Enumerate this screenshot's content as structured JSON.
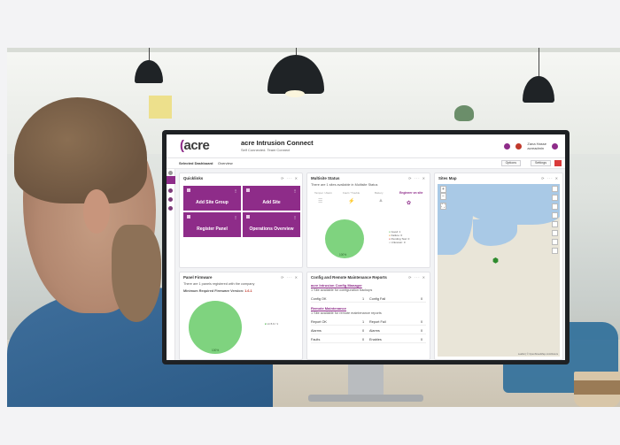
{
  "app": {
    "logo_text": "acre",
    "title": "acre Intrusion Connect",
    "subtitle": "Self Connected. Team Connect",
    "user": [
      "Zana Hasse",
      "acreadmin"
    ]
  },
  "subbar": {
    "selected_label": "Selected Dashboard",
    "dashboard_value": "Overview",
    "views_button": "Options",
    "settings_button": "Settings"
  },
  "quicklinks": {
    "title": "Quicklinks",
    "tiles": [
      "Add Site Group",
      "Add Site",
      "Register Panel",
      "Operations Overview"
    ]
  },
  "multisite": {
    "title": "Multisite Status",
    "description": "There are 1 sites available in Multisite Status",
    "columns": [
      "Tamper / Alarm",
      "Fault / Trouble",
      "Battery",
      "Engineer on site"
    ],
    "pie_label": "100%",
    "legend": [
      "Good: 1",
      "Failure: 0",
      "Pending Test: 0",
      "Unknown: 0"
    ]
  },
  "sites_map": {
    "title": "Sites Map",
    "attribution": "Leaflet | © OpenStreetMap contributors"
  },
  "panel_firmware": {
    "title": "Panel Firmware",
    "description": "There are 1 panels registered with the company",
    "min_label": "Minimum Required Firmware Version:",
    "min_value": "1.6.1",
    "pie_label": "100%",
    "legend": "v1.5.0 / 1"
  },
  "config_reports": {
    "title": "Config and Remote Maintenance Reports",
    "description": "1 Site available for configuration backups",
    "config_link": "acre Intrusion Config Manager",
    "config_ok_label": "Config OK",
    "config_ok_value": "1",
    "config_fail_label": "Config Fail",
    "config_fail_value": "0",
    "maint_link": "Remote Maintenance",
    "maint_desc": "1 Site available for remote maintenance reports",
    "report_ok_label": "Report OK",
    "report_ok_value": "1",
    "report_fail_label": "Report Fail",
    "report_fail_value": "0",
    "alarms_label": "Alarms",
    "alarms_value": "0",
    "alarms2_label": "Alarms",
    "alarms2_value": "0",
    "faults_label": "Faults",
    "faults_value": "0",
    "enables_label": "Enables",
    "enables_value": "0"
  },
  "colors": {
    "accent": "#8e2c89",
    "pie_green": "#7fd37f",
    "sea": "#a9c9e6"
  }
}
